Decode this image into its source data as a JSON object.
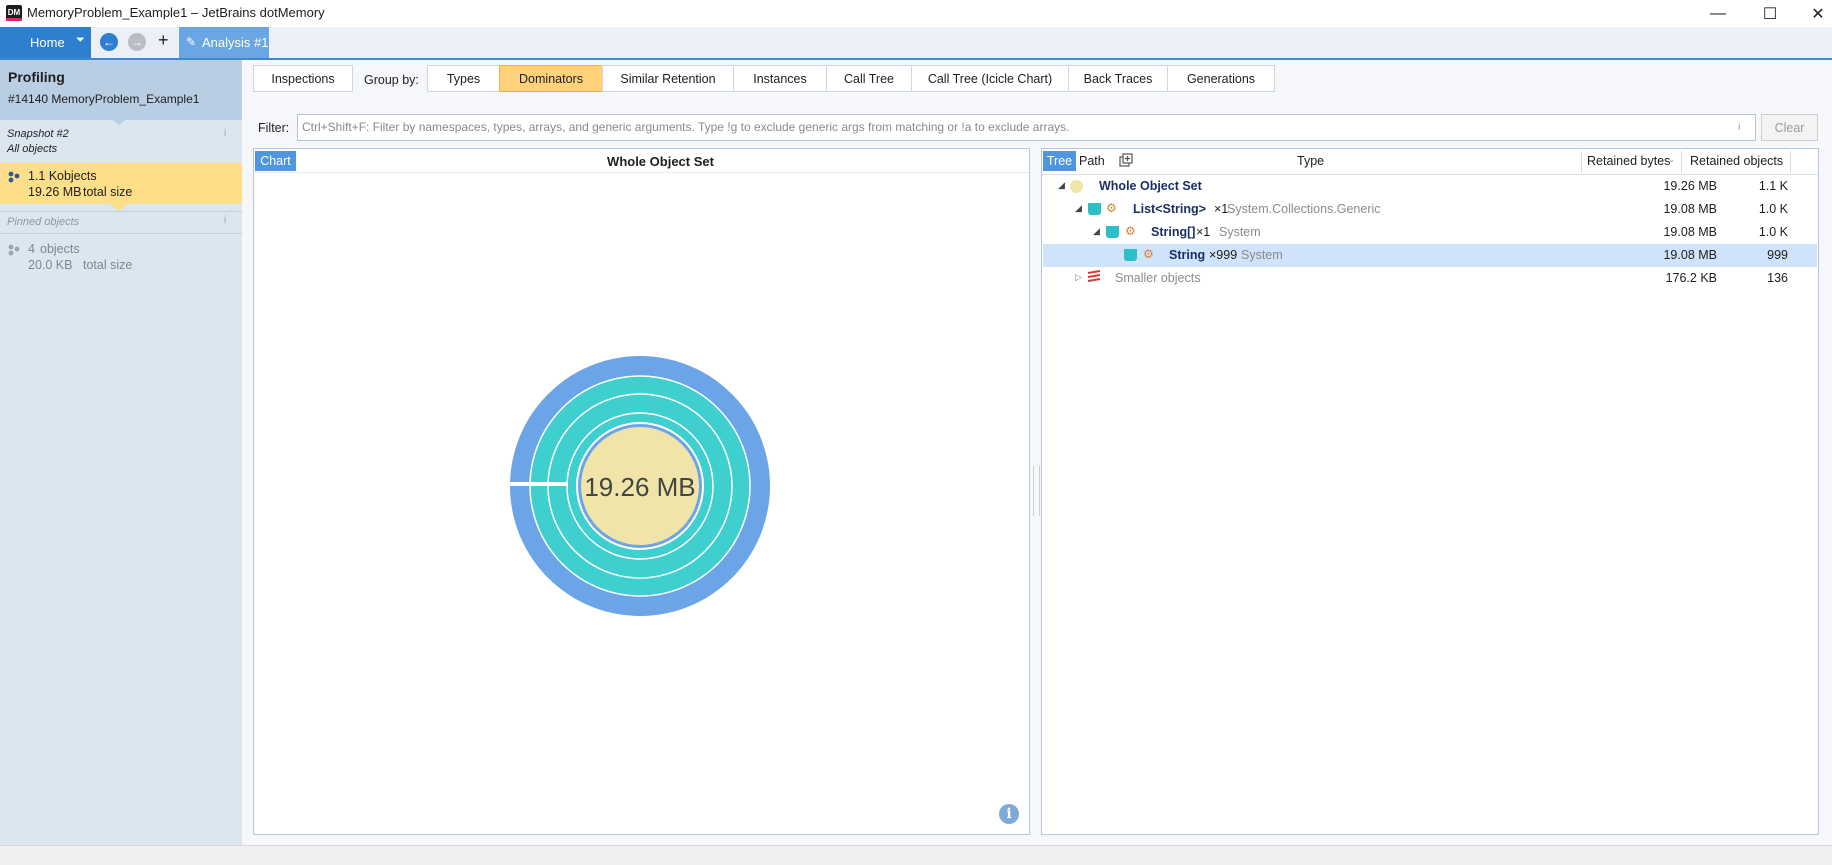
{
  "window": {
    "title": "MemoryProblem_Example1 – JetBrains dotMemory",
    "app_icon_text": "DM",
    "minimize": "—",
    "maximize": "☐",
    "close": "✕"
  },
  "toolbar": {
    "home_label": "Home",
    "home_dropdown": "⏷",
    "back_icon": "←",
    "forward_icon": "→",
    "add_icon": "+",
    "analysis_tab": "Analysis #1",
    "analysis_icon": "✎"
  },
  "sidebar": {
    "title": "Profiling",
    "process": "#14140 MemoryProblem_Example1",
    "snapshot_name": "Snapshot #2",
    "snapshot_sub": "All objects",
    "all_objects": {
      "count": "1.1 K",
      "count_unit": "objects",
      "size": "19.26 MB",
      "size_unit": "total size"
    },
    "pinned_label": "Pinned objects",
    "pinned": {
      "count": "4",
      "count_unit": "objects",
      "size": "20.0 KB",
      "size_unit": "total size"
    },
    "info_glyph": "i"
  },
  "tabs": {
    "inspections": "Inspections",
    "groupby_label": "Group by:",
    "items": [
      "Types",
      "Dominators",
      "Similar Retention",
      "Instances",
      "Call Tree",
      "Call Tree (Icicle Chart)",
      "Back Traces",
      "Generations"
    ],
    "active": "Dominators"
  },
  "filter": {
    "label": "Filter:",
    "placeholder": "Ctrl+Shift+F: Filter by namespaces, types, arrays, and generic arguments. Type !g to exclude generic args from matching or !a to exclude arrays.",
    "clear": "Clear",
    "info": "i"
  },
  "chart_panel": {
    "tab": "Chart",
    "title": "Whole Object Set",
    "info": "i"
  },
  "chart_data": {
    "type": "sunburst",
    "center_label": "19.26 MB",
    "total_bytes_mb": 19.26,
    "rings": [
      {
        "level": 1,
        "name": "List<String>",
        "value_mb": 19.08,
        "color": "#3fcfcf"
      },
      {
        "level": 2,
        "name": "String[]",
        "value_mb": 19.08,
        "color": "#3fcfcf"
      },
      {
        "level": 3,
        "name": "String",
        "value_mb": 19.08,
        "color": "#3fcfcf"
      },
      {
        "level": 0,
        "name": "Smaller objects",
        "value_mb": 0.176,
        "color": "#e8e8e8"
      }
    ],
    "outer_color": "#6ba5e8",
    "center_color": "#f0e4a8"
  },
  "tree_panel": {
    "tree_tab": "Tree",
    "path_tab": "Path",
    "col_type": "Type",
    "col_bytes": "Retained bytes",
    "col_objects": "Retained objects",
    "sort_glyph": "⌄",
    "rows": [
      {
        "expander": "◢",
        "name": "Whole Object Set",
        "suffix": "",
        "ns": "",
        "bytes": "19.26 MB",
        "objects": "1.1 K"
      },
      {
        "expander": "◢",
        "name": "List<String>",
        "suffix": "×1",
        "ns": "System.Collections.Generic",
        "bytes": "19.08 MB",
        "objects": "1.0 K"
      },
      {
        "expander": "◢",
        "name": "String[]",
        "suffix": "×1",
        "ns": "System",
        "bytes": "19.08 MB",
        "objects": "1.0 K"
      },
      {
        "expander": "",
        "name": "String",
        "suffix": "×999",
        "ns": "System",
        "bytes": "19.08 MB",
        "objects": "999"
      },
      {
        "expander": "▷",
        "name": "Smaller objects",
        "suffix": "",
        "ns": "",
        "bytes": "176.2 KB",
        "objects": "136"
      }
    ]
  }
}
